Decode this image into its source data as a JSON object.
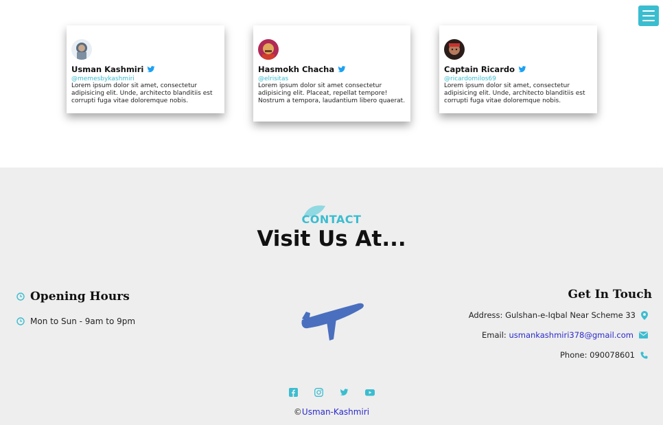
{
  "header": {
    "menu_icon": "hamburger-icon",
    "accent": "#3bbdd0"
  },
  "testimonials": [
    {
      "name": "Usman Kashmiri",
      "handle": "@memesbykashmiri",
      "text": "Lorem ipsum dolor sit amet, consectetur adipisicing elit. Unde, architecto blanditiis est corrupti fuga vitae doloremque nobis."
    },
    {
      "name": "Hasmokh Chacha",
      "handle": "@elrisitas",
      "text": "Lorem ipsum dolor sit amet consectetur adipisicing elit. Placeat, repellat tempore! Nostrum a tempora, laudantium libero quaerat."
    },
    {
      "name": "Captain Ricardo",
      "handle": "@ricardomilos69",
      "text": "Lorem ipsum dolor sit amet, consectetur adipisicing elit. Unde, architecto blanditiis est corrupti fuga vitae doloremque nobis."
    }
  ],
  "contact": {
    "label": "CONTACT",
    "title": "Visit Us At...",
    "opening": {
      "title": "Opening Hours",
      "hours": "Mon to Sun - 9am to 9pm"
    },
    "touch": {
      "title": "Get In Touch",
      "address_label": "Address:",
      "address": "Gulshan-e-Iqbal Near Scheme 33",
      "email_label": "Email:",
      "email": "usmankashmiri378@gmail.com",
      "phone_label": "Phone:",
      "phone": "090078601"
    }
  },
  "footer": {
    "social_icons": [
      "facebook-icon",
      "instagram-icon",
      "twitter-icon",
      "youtube-icon"
    ],
    "copyright_symbol": "©",
    "copyright_link": "Usman-Kashmiri"
  }
}
